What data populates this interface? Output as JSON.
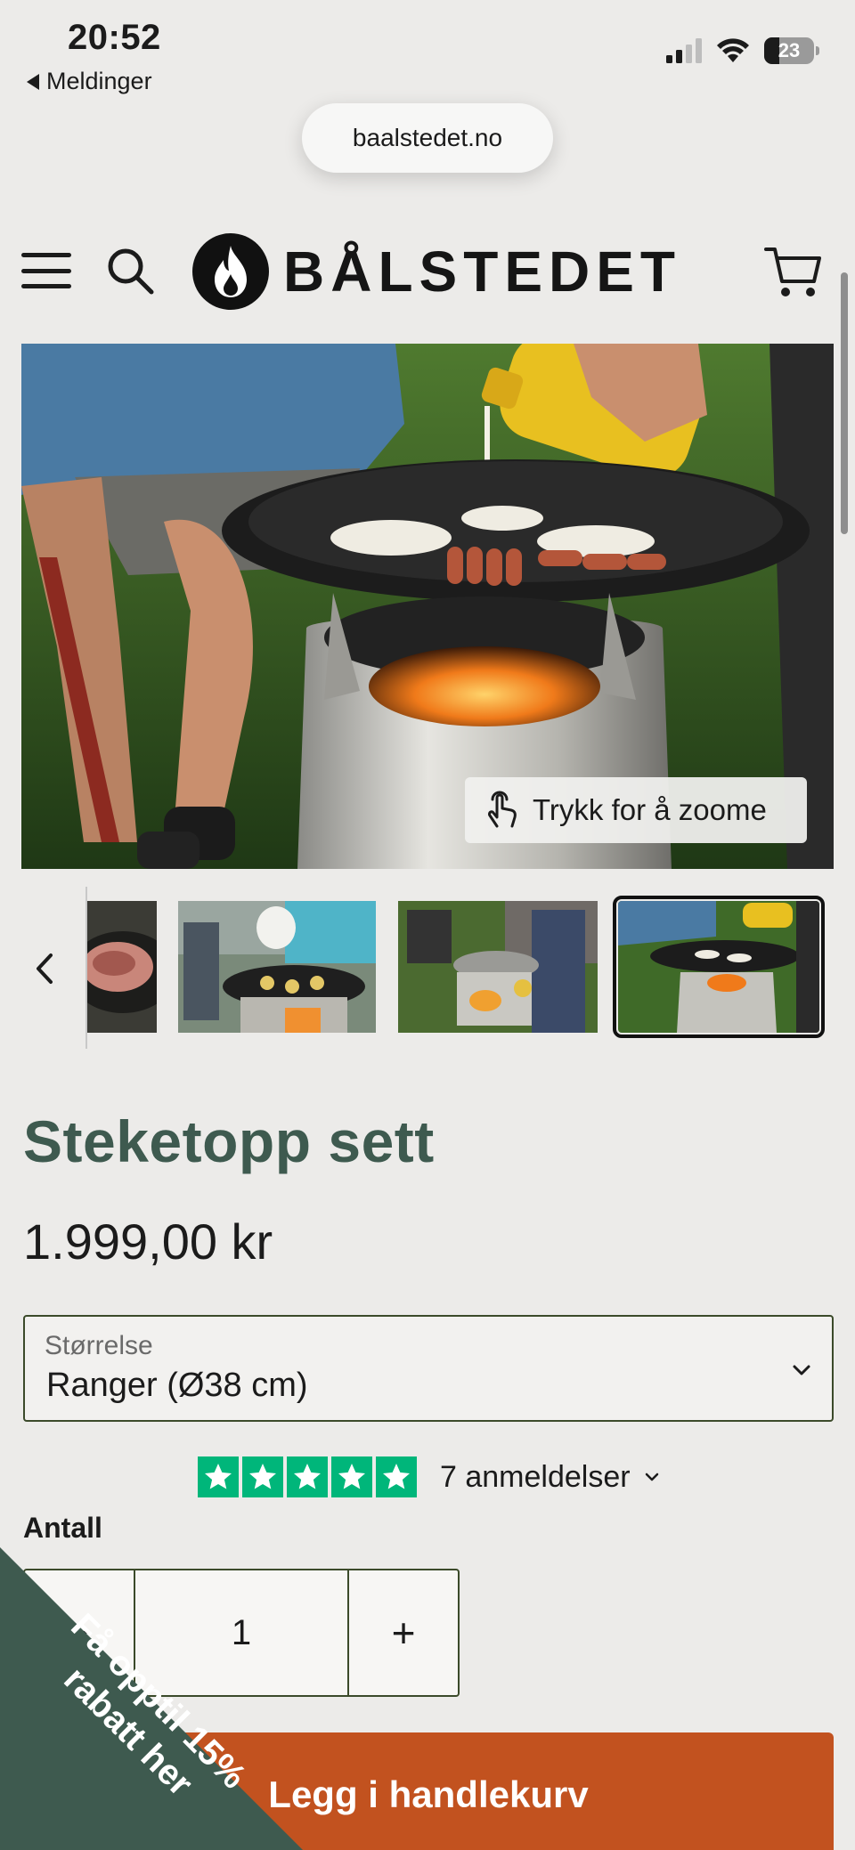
{
  "status_bar": {
    "time": "20:52",
    "back_label": "Meldinger",
    "battery": "23"
  },
  "browser": {
    "url": "baalstedet.no"
  },
  "header": {
    "logo_text": "BÅLSTEDET"
  },
  "hero": {
    "zoom_hint": "Trykk for å zoome"
  },
  "product": {
    "title": "Steketopp sett",
    "price": "1.999,00 kr",
    "size": {
      "label": "Størrelse",
      "value": "Ranger (Ø38 cm)"
    },
    "reviews": {
      "rating": 5,
      "text": "7 anmeldelser"
    },
    "quantity": {
      "label": "Antall",
      "value": "1",
      "minus": "−",
      "plus": "+"
    },
    "add_to_cart": "Legg i handlekurv"
  },
  "promo": {
    "text": "Få opptil 15% rabatt her"
  },
  "colors": {
    "brand_green": "#3e5a4f",
    "cta_orange": "#c2521f",
    "trustpilot_green": "#00b67a",
    "background": "#ecebe9"
  }
}
